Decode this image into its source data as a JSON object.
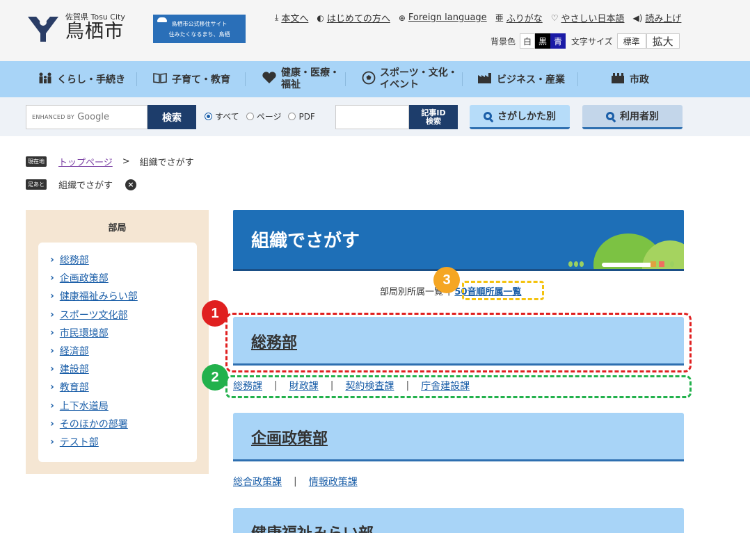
{
  "header": {
    "prefecture_label": "佐賀県 Tosu City",
    "city_name": "鳥栖市",
    "banner_line1": "鳥栖市公式移住サイト",
    "banner_line2": "住みたくなるまち、鳥栖",
    "top_links": [
      {
        "icon": "download-icon",
        "glyph": "⤓",
        "label": "本文へ"
      },
      {
        "icon": "beginner-icon",
        "glyph": "◐",
        "label": "はじめての方へ"
      },
      {
        "icon": "globe-icon",
        "glyph": "⊕",
        "label": "Foreign language"
      },
      {
        "icon": "ruby-icon",
        "glyph": "亜",
        "label": "ふりがな"
      },
      {
        "icon": "heart-icon",
        "glyph": "♡",
        "label": "やさしい日本語"
      },
      {
        "icon": "speaker-icon",
        "glyph": "◀)",
        "label": "読み上げ"
      }
    ],
    "bg_color_label": "背景色",
    "bg_options": [
      "白",
      "黒",
      "青"
    ],
    "font_size_label": "文字サイズ",
    "font_standard": "標準",
    "font_large": "拡大"
  },
  "gnav": [
    {
      "icon": "people-icon",
      "glyph": "👪",
      "label": "くらし・手続き"
    },
    {
      "icon": "book-icon",
      "glyph": "📖",
      "label": "子育て・教育"
    },
    {
      "icon": "heart-icon",
      "glyph": "♥",
      "label": "健康・医療・福祉"
    },
    {
      "icon": "soccer-icon",
      "glyph": "⚽",
      "label": "スポーツ・文化・イベント"
    },
    {
      "icon": "factory-icon",
      "glyph": "▙",
      "label": "ビジネス・産業"
    },
    {
      "icon": "cityhall-icon",
      "glyph": "▦",
      "label": "市政"
    }
  ],
  "search": {
    "google_prefix": "ENHANCED BY",
    "google_label": "Google",
    "search_button": "検索",
    "radio_all": "すべて",
    "radio_page": "ページ",
    "radio_pdf": "PDF",
    "article_id_button_line1": "記事ID",
    "article_id_button_line2": "検索",
    "by_method": "さがしかた別",
    "by_user": "利用者別"
  },
  "breadcrumb": {
    "current_tag": "現在地",
    "home": "トップページ",
    "separator": ">",
    "current": "組織でさがす",
    "history_tag": "足あと",
    "history_item": "組織でさがす"
  },
  "sidebar": {
    "title": "部局",
    "items": [
      "総務部",
      "企画政策部",
      "健康福祉みらい部",
      "スポーツ文化部",
      "市民環境部",
      "経済部",
      "建設部",
      "教育部",
      "上下水道局",
      "そのほかの部署",
      "テスト部"
    ]
  },
  "main": {
    "title": "組織でさがす",
    "subnav_current": "部局別所属一覧",
    "subnav_pipe": "|",
    "subnav_link": "50音順所属一覧",
    "departments": [
      {
        "name": "総務部",
        "sections": [
          "総務課",
          "財政課",
          "契約検査課",
          "庁舎建設課"
        ]
      },
      {
        "name": "企画政策部",
        "sections": [
          "総合政策課",
          "情報政策課"
        ]
      },
      {
        "name": "健康福祉みらい部",
        "sections": []
      }
    ],
    "section_pipe": "|"
  },
  "annotations": [
    "1",
    "2",
    "3"
  ],
  "colors": {
    "nav_bg": "#a8d4f7",
    "hero_bg": "#1e6fb7",
    "dark_button": "#1d3d6b",
    "sidebar_bg": "#f5e6d3",
    "annotation_red": "#e02020",
    "annotation_green": "#22b14c",
    "annotation_yellow": "#f5a623"
  }
}
